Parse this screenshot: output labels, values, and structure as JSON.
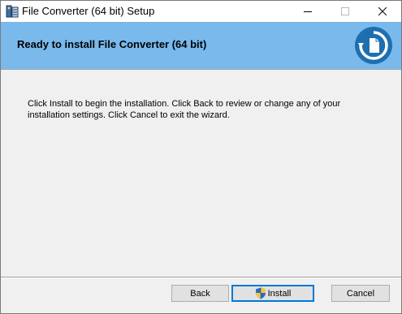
{
  "window": {
    "title": "File Converter (64 bit) Setup",
    "controls": {
      "minimize_icon": "minimize-icon",
      "maximize_icon": "maximize-icon",
      "close_icon": "close-icon"
    }
  },
  "banner": {
    "title": "Ready to install File Converter (64 bit)",
    "logo_icon": "file-converter-logo-icon",
    "background_color": "#79b9ec"
  },
  "body": {
    "message": "Click Install to begin the installation. Click Back to review or change any of your installation settings. Click Cancel to exit the wizard."
  },
  "buttons": {
    "back_label": "Back",
    "install_label": "Install",
    "install_icon": "uac-shield-icon",
    "cancel_label": "Cancel",
    "default_focus_color": "#0078d7"
  }
}
